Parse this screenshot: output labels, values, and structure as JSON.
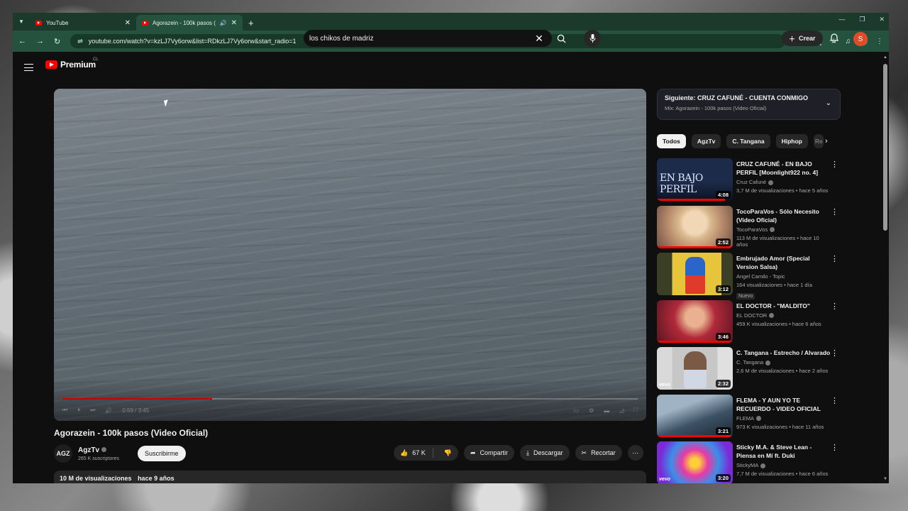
{
  "browser": {
    "tabs": [
      {
        "title": "YouTube"
      },
      {
        "title": "Agorazein - 100k pasos (Vi"
      }
    ],
    "url": "youtube.com/watch?v=kzLJ7Vy6orw&list=RDkzLJ7Vy6orw&start_radio=1",
    "profile_initial": "S"
  },
  "header": {
    "logo_text": "Premium",
    "country_code": "CL",
    "search_query": "los chikos de madriz",
    "create_label": "Crear",
    "avatar_initial": "S"
  },
  "player": {
    "time": "0:59 / 3:45",
    "progress_fraction": 0.26
  },
  "video": {
    "title": "Agorazein - 100k pasos (Video Oficial)",
    "channel_avatar_text": "AGZ",
    "channel_name": "AgzTv",
    "subscribers": "265 K suscriptores",
    "subscribe_label": "Suscribirme",
    "likes": "67 K",
    "share_label": "Compartir",
    "download_label": "Descargar",
    "clip_label": "Recortar",
    "views": "10 M de visualizaciones",
    "age": "hace 9 años"
  },
  "up_next": {
    "line1": "Siguiente: CRUZ CAFUNÉ - CUENTA CONMIGO",
    "line2": "Mix: Agorazein - 100k pasos (Video Oficial)"
  },
  "chips": [
    "Todos",
    "AgzTv",
    "C. Tangana",
    "Hiphop",
    "Re"
  ],
  "recommendations": [
    {
      "title": "CRUZ CAFUNÉ - EN BAJO PERFIL [Moonlight922 no. 4]",
      "channel": "Cruz Cafuné",
      "meta": "3,7 M de visualizaciones • hace 5 años",
      "duration": "4:08",
      "overlay": "EN BAJO PERFIL",
      "watched": 0.9
    },
    {
      "title": "TocoParaVos - Sólo Necesito (Video Oficial)",
      "channel": "TocoParaVos",
      "meta": "113 M de visualizaciones • hace 10 años",
      "duration": "2:52",
      "watched": 1.0
    },
    {
      "title": "Embrujado Amor (Special Version Salsa)",
      "channel": "Angel Camilo - Topic",
      "meta": "164 visualizaciones • hace 1 día",
      "duration": "3:12",
      "badge": "Nuevo"
    },
    {
      "title": "EL DOCTOR - \"MALDITO\"",
      "channel": "EL DOCTOR",
      "meta": "459 K visualizaciones • hace 6 años",
      "duration": "3:46",
      "watched": 1.0
    },
    {
      "title": "C. Tangana - Estrecho / Alvarado",
      "channel": "C. Tangana",
      "meta": "2,6 M de visualizaciones • hace 2 años",
      "duration": "2:32",
      "vevo": "vevo"
    },
    {
      "title": "FLEMA - Y AUN YO TE RECUERDO - VIDEO OFICIAL",
      "channel": "FLEMA",
      "meta": "973 K visualizaciones • hace 11 años",
      "duration": "3:21",
      "watched": 1.0
    },
    {
      "title": "Sticky M.A. & Steve Lean - Piensa en Mí ft. Duki",
      "channel": "StickyMA",
      "meta": "7,7 M de visualizaciones • hace 6 años",
      "duration": "3:20",
      "vevo": "vevo"
    }
  ]
}
